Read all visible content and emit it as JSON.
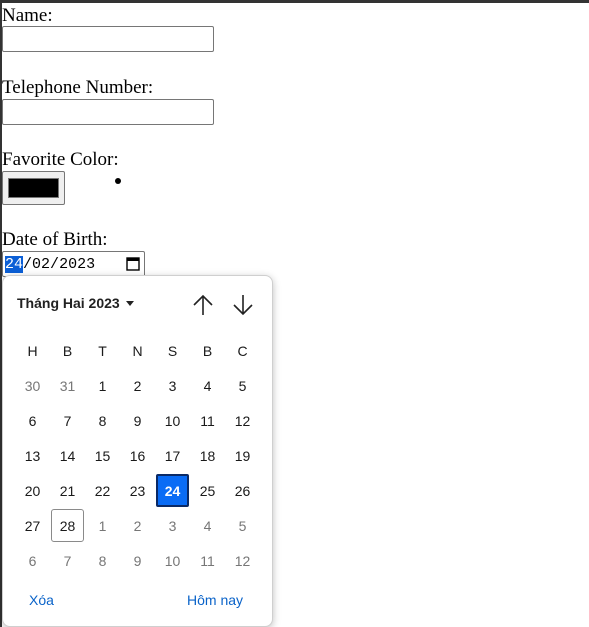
{
  "form": {
    "name_label": "Name:",
    "name_value": "",
    "phone_label": "Telephone Number:",
    "phone_value": "",
    "color_label": "Favorite Color:",
    "color_value": "#000000",
    "dob_label": "Date of Birth:",
    "dob_day": "24",
    "dob_month": "02",
    "dob_year": "2023",
    "dob_separator": "/"
  },
  "calendar": {
    "month_year": "Tháng Hai 2023",
    "weekdays": [
      "H",
      "B",
      "T",
      "N",
      "S",
      "B",
      "C"
    ],
    "weeks": [
      [
        {
          "d": "30",
          "m": true
        },
        {
          "d": "31",
          "m": true
        },
        {
          "d": "1"
        },
        {
          "d": "2"
        },
        {
          "d": "3"
        },
        {
          "d": "4"
        },
        {
          "d": "5"
        }
      ],
      [
        {
          "d": "6"
        },
        {
          "d": "7"
        },
        {
          "d": "8"
        },
        {
          "d": "9"
        },
        {
          "d": "10"
        },
        {
          "d": "11"
        },
        {
          "d": "12"
        }
      ],
      [
        {
          "d": "13"
        },
        {
          "d": "14"
        },
        {
          "d": "15"
        },
        {
          "d": "16"
        },
        {
          "d": "17"
        },
        {
          "d": "18"
        },
        {
          "d": "19"
        }
      ],
      [
        {
          "d": "20"
        },
        {
          "d": "21"
        },
        {
          "d": "22"
        },
        {
          "d": "23"
        },
        {
          "d": "24",
          "sel": true
        },
        {
          "d": "25"
        },
        {
          "d": "26"
        }
      ],
      [
        {
          "d": "27"
        },
        {
          "d": "28",
          "today": true
        },
        {
          "d": "1",
          "m": true
        },
        {
          "d": "2",
          "m": true
        },
        {
          "d": "3",
          "m": true
        },
        {
          "d": "4",
          "m": true
        },
        {
          "d": "5",
          "m": true
        }
      ],
      [
        {
          "d": "6",
          "m": true
        },
        {
          "d": "7",
          "m": true
        },
        {
          "d": "8",
          "m": true
        },
        {
          "d": "9",
          "m": true
        },
        {
          "d": "10",
          "m": true
        },
        {
          "d": "11",
          "m": true
        },
        {
          "d": "12",
          "m": true
        }
      ]
    ],
    "clear_label": "Xóa",
    "today_label": "Hôm nay",
    "accent_color": "#0a6cf5"
  },
  "icons": {
    "calendar": "calendar-icon",
    "prev": "arrow-up-icon",
    "next": "arrow-down-icon",
    "month_dropdown": "caret-down-icon"
  }
}
